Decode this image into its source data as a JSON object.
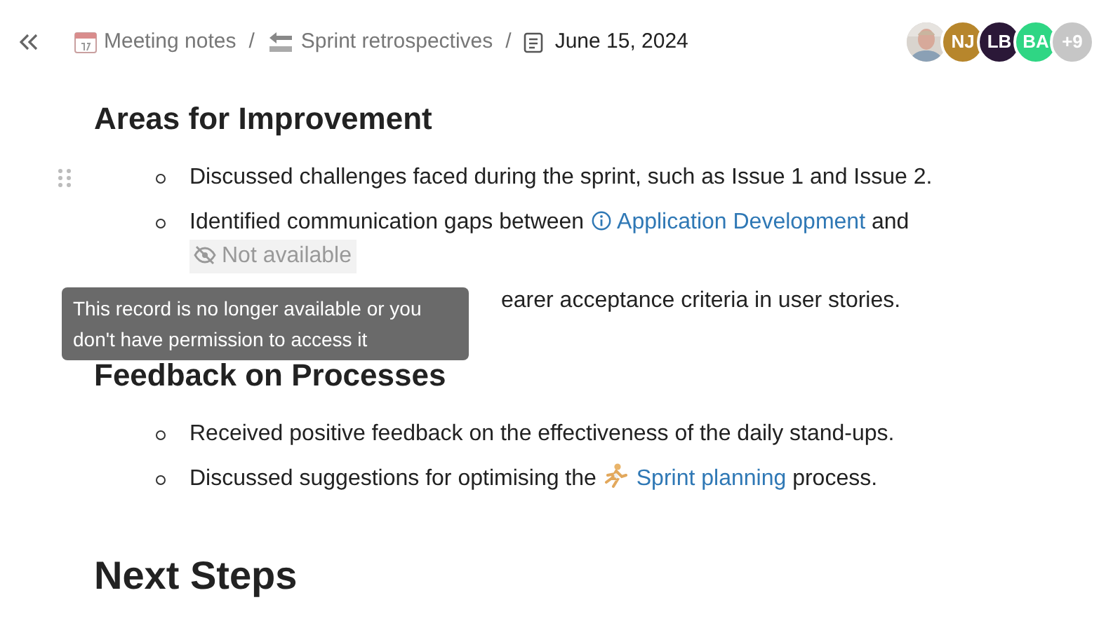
{
  "breadcrumb": {
    "separator": "/",
    "items": [
      {
        "label": "Meeting notes",
        "current": false
      },
      {
        "label": "Sprint retrospectives",
        "current": false
      },
      {
        "label": "June 15, 2024",
        "current": true
      }
    ]
  },
  "avatars": [
    {
      "kind": "picture"
    },
    {
      "kind": "initials",
      "initials": "NJ",
      "color": "#b7862c"
    },
    {
      "kind": "initials",
      "initials": "LB",
      "color": "#2b1838"
    },
    {
      "kind": "initials",
      "initials": "BA",
      "color": "#2fd684"
    },
    {
      "kind": "count",
      "text": "+9",
      "color": "#c6c6c6"
    }
  ],
  "sections": [
    {
      "heading": "Areas for Improvement",
      "items": [
        {
          "covered": false,
          "parts": [
            {
              "kind": "text",
              "text": "Discussed challenges faced during the sprint, such as Issue 1 and Issue 2."
            }
          ]
        },
        {
          "covered": false,
          "parts": [
            {
              "kind": "text",
              "text": "Identified communication gaps between "
            },
            {
              "kind": "link",
              "text": "Application Development"
            },
            {
              "kind": "text",
              "text": " and "
            },
            {
              "kind": "unavailable",
              "text": "Not available"
            }
          ]
        },
        {
          "covered": true,
          "parts": [
            {
              "kind": "text",
              "text": "earer acceptance criteria in user stories."
            }
          ]
        }
      ]
    },
    {
      "heading": "Feedback on Processes",
      "items": [
        {
          "covered": false,
          "parts": [
            {
              "kind": "text",
              "text": "Received positive feedback on the effectiveness of the daily stand-ups."
            }
          ]
        },
        {
          "covered": false,
          "parts": [
            {
              "kind": "text",
              "text": "Discussed suggestions for optimising the "
            },
            {
              "kind": "link",
              "text": "Sprint planning"
            },
            {
              "kind": "text",
              "text": " process."
            }
          ]
        }
      ]
    },
    {
      "heading": "Next Steps"
    }
  ],
  "tooltip": {
    "text": "This record is no longer available or you don't have permission to access it"
  }
}
